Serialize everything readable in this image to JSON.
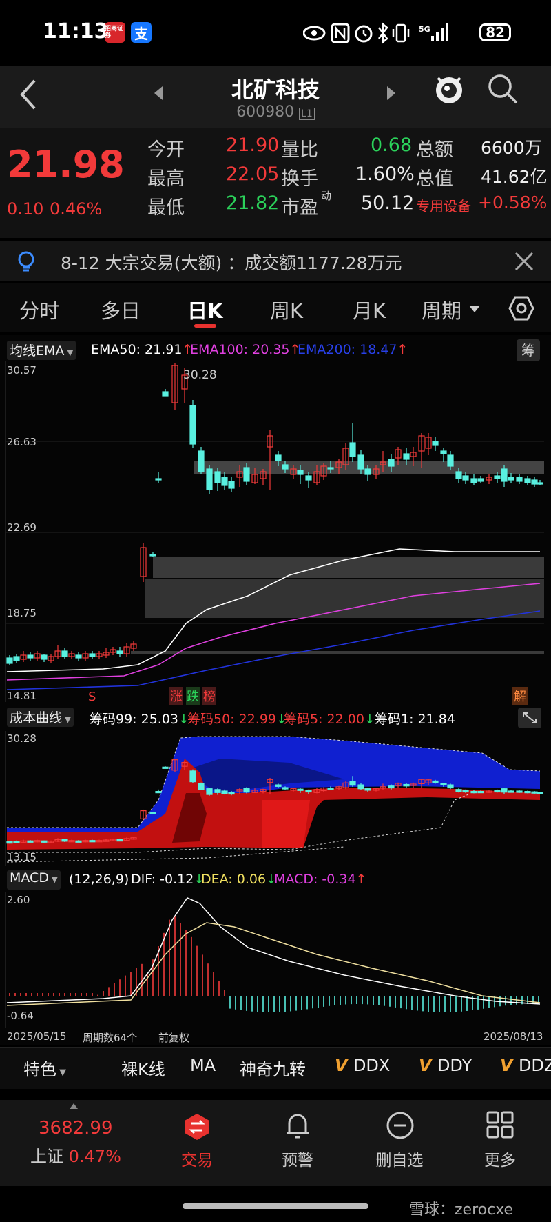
{
  "status_bar": {
    "time": "11:13",
    "battery": "82",
    "app_icon_1": "招商证券",
    "app_icon_2": "支"
  },
  "header": {
    "title": "北矿科技",
    "code": "600980",
    "badge": "L1"
  },
  "quote": {
    "price": "21.98",
    "change": "0.10",
    "change_pct": "0.46%",
    "open_label": "今开",
    "open": "21.90",
    "high_label": "最高",
    "high": "22.05",
    "low_label": "最低",
    "low": "21.82",
    "vol_ratio_label": "量比",
    "vol_ratio": "0.68",
    "turnover_label": "换手",
    "turnover": "1.60%",
    "pe_label": "市盈",
    "pe_sup": "动",
    "pe": "50.12",
    "amount_label": "总额",
    "amount": "6600万",
    "mktcap_label": "总值",
    "mktcap": "41.62亿",
    "sector": "专用设备",
    "sector_pct": "+0.58%"
  },
  "notice": {
    "text": "8-12 大宗交易(大额) ：成交额1177.28万元"
  },
  "tabs": [
    "分时",
    "多日",
    "日K",
    "周K",
    "月K",
    "周期"
  ],
  "main_chart": {
    "indicator": "均线EMA",
    "ema50": "EMA50: 21.91",
    "ema100": "EMA100: 20.35",
    "ema200": "EMA200: 18.47",
    "arrow": "↑",
    "y_ticks": [
      "30.57",
      "26.63",
      "22.69",
      "18.75",
      "14.81"
    ],
    "high_marker": "30.28",
    "chip_btn": "筹",
    "markers": {
      "s": "S",
      "zhang": "涨",
      "die": "跌",
      "bang": "榜",
      "jie": "解"
    }
  },
  "cost_chart": {
    "indicator": "成本曲线",
    "c99": "筹码99: 25.03",
    "c50": "筹码50: 22.99",
    "c5": "筹码5: 22.00",
    "c1": "筹码1: 21.84",
    "arrow": "↓",
    "y_ticks": [
      "30.28",
      "13.15"
    ]
  },
  "macd_chart": {
    "indicator": "MACD",
    "params": "(12,26,9)",
    "dif": "DIF: -0.12",
    "dea": "DEA: 0.06",
    "macd": "MACD: -0.34",
    "dif_arrow": "↓",
    "dea_arrow": "↓",
    "macd_arrow": "↑",
    "y_ticks": [
      "2.60",
      "-0.64"
    ]
  },
  "footer_info": {
    "start_date": "2025/05/15",
    "period": "周期数64个",
    "adjust": "前复权",
    "end_date": "2025/08/13"
  },
  "feature_bar": {
    "items": [
      "特色",
      "裸K线",
      "MA",
      "神奇九转",
      "DDX",
      "DDY",
      "DDZ"
    ]
  },
  "bottom_nav": {
    "index_value": "3682.99",
    "index_name": "上证",
    "index_pct": "0.47%",
    "items": [
      "交易",
      "预警",
      "删自选",
      "更多"
    ]
  },
  "watermark": "雪球：zerocxe",
  "colors": {
    "up": "#f23a3a",
    "down": "#2bd15a",
    "candle_down": "#59f0e0",
    "ema50": "#ffffff",
    "ema100": "#e040e0",
    "ema200": "#2233dd"
  }
}
